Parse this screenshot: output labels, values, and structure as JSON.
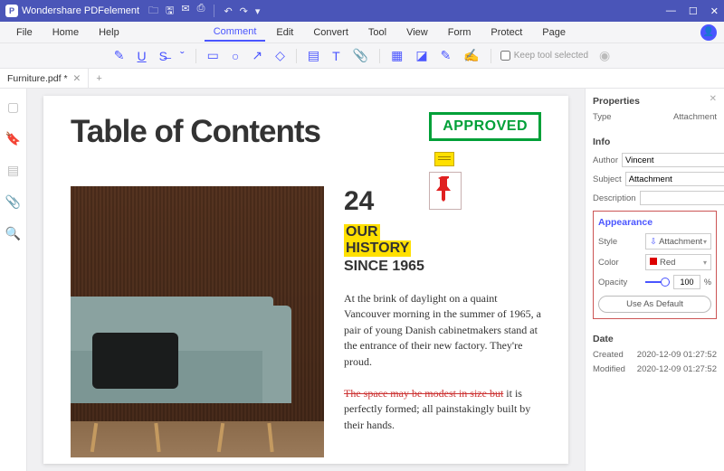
{
  "titlebar": {
    "app_name": "Wondershare PDFelement"
  },
  "menubar": {
    "file": "File",
    "home": "Home",
    "help": "Help",
    "comment": "Comment",
    "edit": "Edit",
    "convert": "Convert",
    "tool": "Tool",
    "view": "View",
    "form": "Form",
    "protect": "Protect",
    "page": "Page"
  },
  "toolbar": {
    "keep_tool": "Keep tool selected"
  },
  "tabs": {
    "t0": "Furniture.pdf *"
  },
  "page": {
    "title": "Table of Contents",
    "stamp": "APPROVED",
    "big": "24",
    "hl1": "OUR",
    "hl2": "HISTORY",
    "since": "SINCE 1965",
    "p1": "At the brink of daylight on a quaint Vancouver morning in the summer of 1965, a pair of young Danish cabinetmakers stand at the entrance of their new factory. They're proud.",
    "p2a": "The space may be modest in size but",
    "p2b": " it is perfectly formed; all painstakingly built by their hands."
  },
  "props": {
    "header": "Properties",
    "type_lbl": "Type",
    "type_val": "Attachment",
    "info": "Info",
    "author_lbl": "Author",
    "author_val": "Vincent",
    "subject_lbl": "Subject",
    "subject_val": "Attachment",
    "desc_lbl": "Description",
    "desc_val": "",
    "appearance": "Appearance",
    "style_lbl": "Style",
    "style_val": "Attachment",
    "color_lbl": "Color",
    "color_val": "Red",
    "opacity_lbl": "Opacity",
    "opacity_val": "100",
    "use_default": "Use As Default",
    "date": "Date",
    "created_lbl": "Created",
    "created_val": "2020-12-09 01:27:52",
    "modified_lbl": "Modified",
    "modified_val": "2020-12-09 01:27:52"
  }
}
